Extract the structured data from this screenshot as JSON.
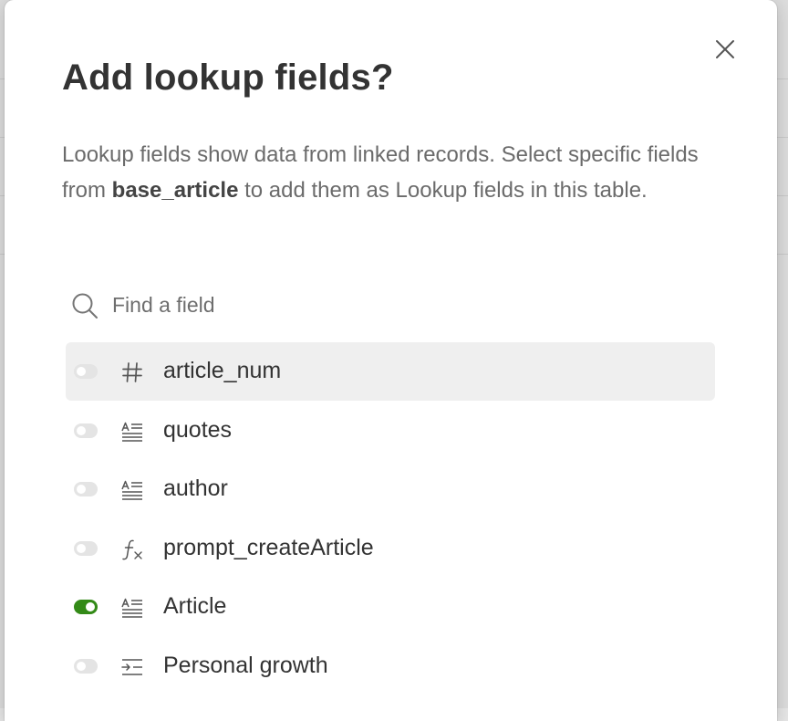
{
  "dialog": {
    "title": "Add lookup fields?",
    "description_before": "Lookup fields show data from linked records. Select specific fields from ",
    "description_table": "base_article",
    "description_after": " to add them as Lookup fields in this table.",
    "close_icon": "close-icon"
  },
  "search": {
    "placeholder": "Find a field",
    "value": "",
    "icon": "search-icon"
  },
  "fields": [
    {
      "label": "article_num",
      "icon": "number-icon",
      "enabled": false,
      "hovered": true
    },
    {
      "label": "quotes",
      "icon": "long-text-icon",
      "enabled": false,
      "hovered": false
    },
    {
      "label": "author",
      "icon": "long-text-icon",
      "enabled": false,
      "hovered": false
    },
    {
      "label": "prompt_createArticle",
      "icon": "formula-icon",
      "enabled": false,
      "hovered": false
    },
    {
      "label": "Article",
      "icon": "long-text-icon",
      "enabled": true,
      "hovered": false
    },
    {
      "label": "Personal growth",
      "icon": "multiple-lookup-icon",
      "enabled": false,
      "hovered": false
    }
  ],
  "colors": {
    "toggle_on": "#338a17",
    "toggle_off": "#e4e4e4",
    "row_hover": "#efefef",
    "title_text": "#333333",
    "description_text": "#6b6b6b"
  }
}
